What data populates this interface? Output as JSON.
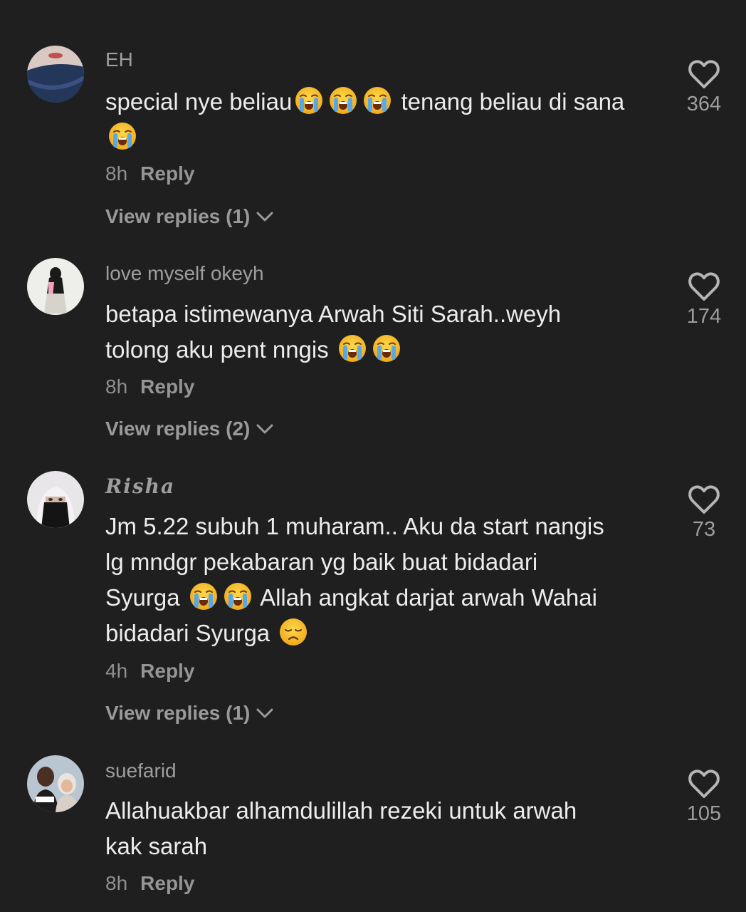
{
  "comments": [
    {
      "username": "EH",
      "text_parts": [
        "special nye beliau",
        "",
        "",
        "",
        " tenang beliau di sana ",
        ""
      ],
      "time": "8h",
      "reply_label": "Reply",
      "view_replies": "View replies (1)",
      "likes": "364",
      "avatar_icon": "avatar-face-closeup"
    },
    {
      "username": "love myself okeyh",
      "text_line1": "betapa istimewanya Arwah Siti Sarah..weyh",
      "text_line2": "tolong aku pent nngis",
      "time": "8h",
      "reply_label": "Reply",
      "view_replies": "View replies (2)",
      "likes": "174",
      "avatar_icon": "avatar-hijab-illustration"
    },
    {
      "username": "Risha",
      "text_line1": "Jm 5.22 subuh 1 muharam.. Aku da start nangis",
      "text_line2": "lg mndgr pekabaran yg baik buat bidadari",
      "text_line3a": "Syurga",
      "text_line3b": "Allah angkat darjat arwah Wahai",
      "text_line4": "bidadari Syurga",
      "time": "4h",
      "reply_label": "Reply",
      "view_replies": "View replies (1)",
      "likes": "73",
      "avatar_icon": "avatar-niqab-photo"
    },
    {
      "username": "suefarid",
      "text_line1": "Allahuakbar alhamdulillah rezeki untuk arwah",
      "text_line2": "kak sarah",
      "time": "8h",
      "reply_label": "Reply",
      "likes": "105",
      "avatar_icon": "avatar-couple-photo"
    }
  ],
  "emoji": {
    "crying": "loudly-crying-face-icon",
    "sad": "disappointed-face-icon"
  },
  "colors": {
    "background": "#1f1f1f",
    "text": "#ececec",
    "muted": "#9e9e9e",
    "emoji_yellow": "#f6c02a",
    "tears": "#5aa7e6"
  }
}
